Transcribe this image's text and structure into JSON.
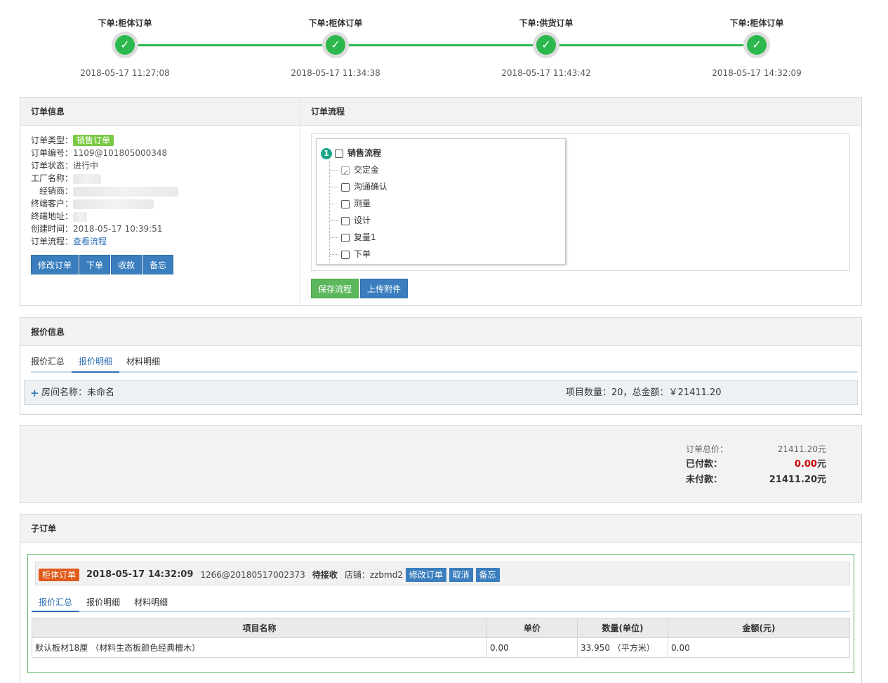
{
  "timeline": [
    {
      "title": "下单:柜体订单",
      "time": "2018-05-17 11:27:08"
    },
    {
      "title": "下单:柜体订单",
      "time": "2018-05-17 11:34:38"
    },
    {
      "title": "下单:供货订单",
      "time": "2018-05-17 11:43:42"
    },
    {
      "title": "下单:柜体订单",
      "time": "2018-05-17 14:32:09"
    }
  ],
  "check_glyph": "✓",
  "order_info": {
    "heading": "订单信息",
    "type_label": "订单类型：",
    "type_value": "销售订单",
    "number_label": "订单编号：",
    "number_value": "1109@101805000348",
    "status_label": "订单状态：",
    "status_value": "进行中",
    "factory_label": "工厂名称：",
    "dealer_label": "经销商：",
    "customer_label": "终端客户：",
    "address_label": "终端地址：",
    "created_label": "创建时间：",
    "created_value": "2018-05-17 10:39:51",
    "flow_label": "订单流程：",
    "flow_link": "查看流程",
    "buttons": {
      "edit": "修改订单",
      "place": "下单",
      "collect": "收款",
      "memo": "备忘"
    }
  },
  "order_flow": {
    "heading": "订单流程",
    "root_num": "1",
    "root_label": "销售流程",
    "items": [
      {
        "label": "交定金",
        "checked": true
      },
      {
        "label": "沟通确认",
        "checked": false
      },
      {
        "label": "测量",
        "checked": false
      },
      {
        "label": "设计",
        "checked": false
      },
      {
        "label": "复量1",
        "checked": false
      },
      {
        "label": "下单",
        "checked": false
      }
    ],
    "save_button": "保存流程",
    "upload_button": "上传附件"
  },
  "quote": {
    "heading": "报价信息",
    "tabs": [
      "报价汇总",
      "报价明细",
      "材料明细"
    ],
    "active_tab": 1,
    "plus": "+",
    "room_label": "房间名称：未命名",
    "room_summary": "项目数量：20，总金额：￥21411.20"
  },
  "totals": {
    "total_label": "订单总价：",
    "total_value": "21411.20元",
    "paid_label": "已付款：",
    "paid_value": "0.00",
    "paid_unit": "元",
    "unpaid_label": "未付款：",
    "unpaid_value": "21411.20元"
  },
  "sub_orders": {
    "heading": "子订单",
    "order": {
      "badge": "柜体订单",
      "date": "2018-05-17 14:32:09",
      "code": "1266@20180517002373",
      "status": "待接收",
      "store": "店铺：zzbmd2",
      "edit": "修改订单",
      "cancel": "取消",
      "memo": "备忘",
      "tabs": [
        "报价汇总",
        "报价明细",
        "材料明细"
      ],
      "active_tab": 0,
      "columns": [
        "项目名称",
        "单价",
        "数量(单位)",
        "金额(元)"
      ],
      "rows": [
        [
          "默认板材18厘 （材料生态板颜色经典檀木）",
          "0.00",
          "33.950 （平方米）",
          "0.00"
        ]
      ]
    }
  }
}
